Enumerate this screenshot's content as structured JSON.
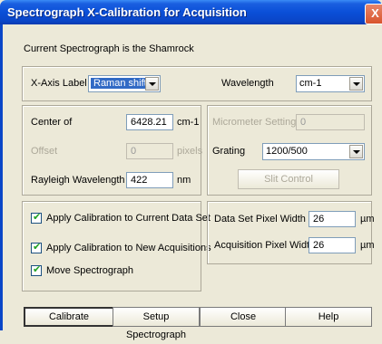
{
  "window": {
    "title": "Spectrograph X-Calibration for Acquisition",
    "close_glyph": "X"
  },
  "info": {
    "current_spectrograph": "Current Spectrograph is the Shamrock"
  },
  "xaxis": {
    "label": "X-Axis Label",
    "value": "Raman shift",
    "wavelength_label": "Wavelength",
    "wavelength_unit": "cm-1"
  },
  "center": {
    "center_label": "Center of",
    "center_value": "6428.21",
    "center_unit": "cm-1",
    "offset_label": "Offset",
    "offset_value": "0",
    "offset_unit": "pixels",
    "rayleigh_label": "Rayleigh Wavelength",
    "rayleigh_value": "422",
    "rayleigh_unit": "nm"
  },
  "spectro": {
    "micrometer_label": "Micrometer Setting",
    "micrometer_value": "0",
    "grating_label": "Grating",
    "grating_value": "1200/500",
    "slit_button": "Slit Control"
  },
  "options": {
    "apply_current": "Apply Calibration to Current Data Set",
    "apply_new": "Apply Calibration to New Acquisitions",
    "move": "Move Spectrograph"
  },
  "pixel": {
    "dataset_label": "Data Set Pixel Width",
    "dataset_value": "26",
    "dataset_unit": "µm",
    "acq_label": "Acquisition Pixel Width",
    "acq_value": "26",
    "acq_unit": "µm"
  },
  "buttons": {
    "calibrate": "Calibrate",
    "setup": "Setup Spectrograph",
    "close": "Close",
    "help": "Help"
  }
}
